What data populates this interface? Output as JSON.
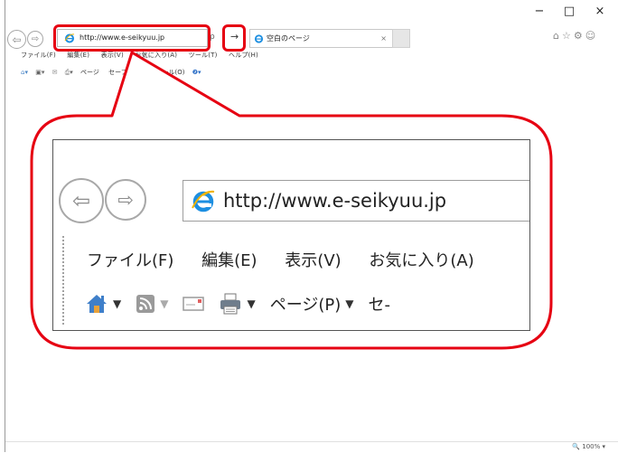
{
  "window": {
    "minimize": "−",
    "maximize": "□",
    "close": "×"
  },
  "address_bar": {
    "url": "http://www.e-seikyuu.jp",
    "search_glyph": "ρ",
    "go_arrow": "→"
  },
  "tab": {
    "title": "空白のページ",
    "close": "×"
  },
  "menu": {
    "file": "ファイル(F)",
    "edit": "編集(E)",
    "view": "表示(V)",
    "favorites": "お気に入り(A)",
    "tools": "ツール(T)",
    "help": "ヘルプ(H)"
  },
  "command_bar": {
    "page": "ページ(P)",
    "page_short": "ページ",
    "safety": "セーフティ(S)",
    "tools": "ツール(O)",
    "truncated": "セ-"
  },
  "right_icons": "⌂☆⚙☺",
  "zoom_panel": {
    "url": "http://www.e-seikyuu.jp"
  },
  "status_bar": {
    "zoom": "100%",
    "zoom_caret": "▾"
  },
  "colors": {
    "highlight": "#e60012",
    "ie_blue": "#1d8fe1",
    "home_orange": "#e8a23b"
  }
}
